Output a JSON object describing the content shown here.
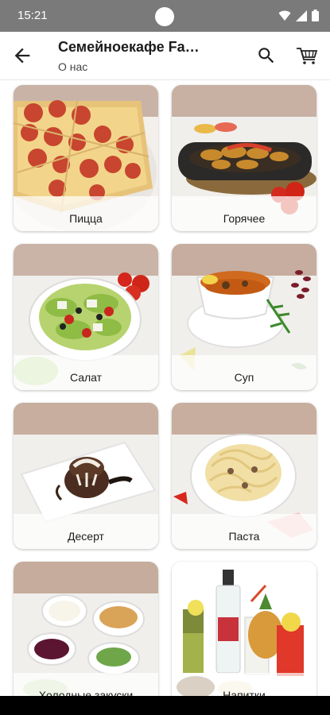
{
  "status_bar": {
    "time": "15:21"
  },
  "app_bar": {
    "title": "Семейноекафе Fa…",
    "subtitle": "О нас"
  },
  "categories": [
    {
      "label": "Пицца"
    },
    {
      "label": "Горячее"
    },
    {
      "label": "Салат"
    },
    {
      "label": "Суп"
    },
    {
      "label": "Десерт"
    },
    {
      "label": "Паста"
    },
    {
      "label": "Холодные закуски"
    },
    {
      "label": "Напитки"
    }
  ],
  "icons": {
    "back": "arrow-back-icon",
    "search": "search-icon",
    "cart": "shopping-cart-icon"
  }
}
